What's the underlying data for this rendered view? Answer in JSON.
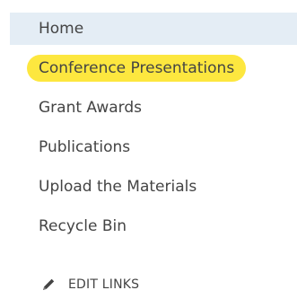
{
  "nav": {
    "items": [
      {
        "label": "Home"
      },
      {
        "label": "Conference Presentations"
      },
      {
        "label": "Grant Awards"
      },
      {
        "label": "Publications"
      },
      {
        "label": "Upload the Materials"
      },
      {
        "label": "Recycle Bin"
      }
    ],
    "edit_links_label": "EDIT LINKS",
    "edit_links_icon": "pencil-icon"
  },
  "colors": {
    "selected_background": "#e4edf5",
    "highlight": "#fde73f",
    "text": "#444444"
  }
}
